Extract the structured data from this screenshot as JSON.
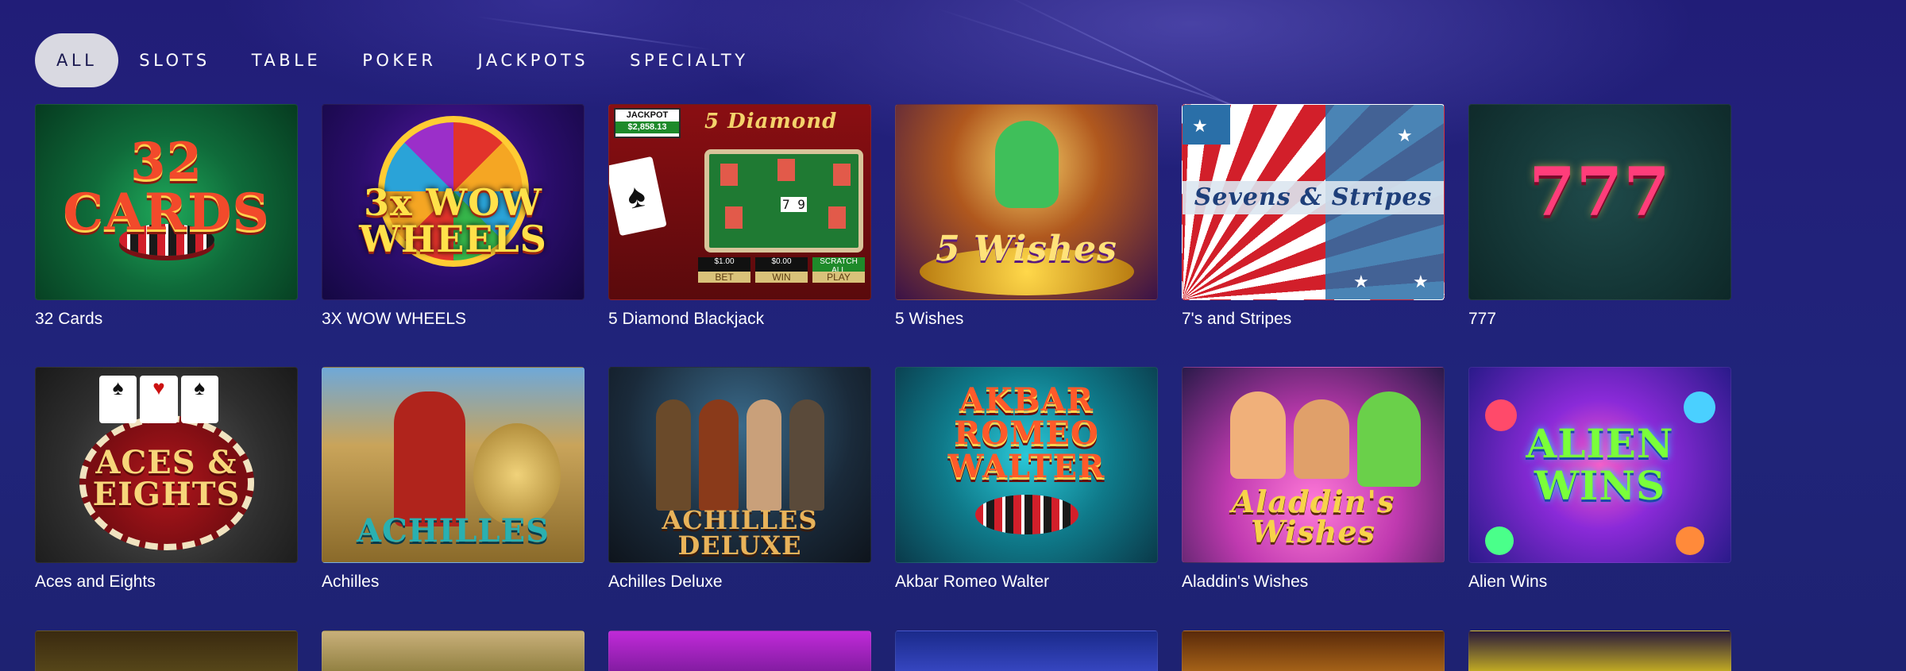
{
  "filters": {
    "tabs": [
      {
        "label": "ALL",
        "active": true
      },
      {
        "label": "SLOTS",
        "active": false
      },
      {
        "label": "TABLE",
        "active": false
      },
      {
        "label": "POKER",
        "active": false
      },
      {
        "label": "JACKPOTS",
        "active": false
      },
      {
        "label": "SPECIALTY",
        "active": false
      }
    ]
  },
  "games": [
    {
      "title": "32 Cards",
      "logo": "32 CARDS"
    },
    {
      "title": "3X WOW WHEELS",
      "logo": "3x WOW WHEELS"
    },
    {
      "title": "5 Diamond Blackjack",
      "logo": "5 Diamond",
      "jackpot_label": "JACKPOT",
      "jackpot_value": "$2,858.13",
      "bet1": "$1.00",
      "bet2": "$0.00",
      "btn_bet": "BET",
      "btn_win": "WIN",
      "btn_play": "PLAY",
      "btn_scratch": "SCRATCH ALL",
      "cards": "7 9"
    },
    {
      "title": "5 Wishes",
      "logo": "5 Wishes"
    },
    {
      "title": "7's and Stripes",
      "logo": "Sevens & Stripes"
    },
    {
      "title": "777",
      "logo": "777"
    },
    {
      "title": "Aces and Eights",
      "logo": "ACES & EIGHTS"
    },
    {
      "title": "Achilles",
      "logo": "ACHILLES"
    },
    {
      "title": "Achilles Deluxe",
      "logo": "ACHILLES DELUXE"
    },
    {
      "title": "Akbar Romeo Walter",
      "logo": "AKBAR ROMEO WALTER"
    },
    {
      "title": "Aladdin's Wishes",
      "logo": "Aladdin's Wishes"
    },
    {
      "title": "Alien Wins",
      "logo": "ALIEN WINS"
    }
  ],
  "colors": {
    "background": "#1e2272",
    "tab_active_bg": "#d9d9e1",
    "text": "#ffffff"
  }
}
